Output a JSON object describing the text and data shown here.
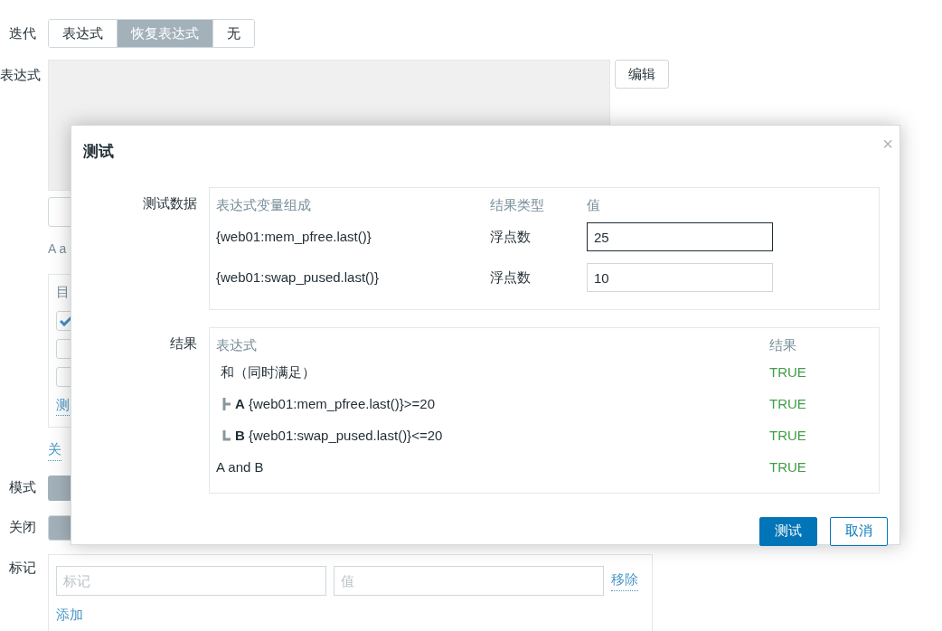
{
  "iteration": {
    "label": "迭代",
    "options": [
      {
        "label": "表达式",
        "selected": false
      },
      {
        "label": "恢复表达式",
        "selected": true
      },
      {
        "label": "无",
        "selected": false
      }
    ]
  },
  "expression": {
    "label": "表达式",
    "edit_button": "编辑"
  },
  "hint": "A a",
  "panel": {
    "header": "目",
    "checkboxes": [
      {
        "checked": true
      },
      {
        "checked": false
      },
      {
        "checked": false
      }
    ],
    "link": "测"
  },
  "close_link": "关",
  "mode_label": "模式",
  "close_label": "关闭",
  "tags": {
    "label": "标记",
    "rows": [
      {
        "tag_placeholder": "标记",
        "value_placeholder": "值",
        "remove": "移除"
      }
    ],
    "add": "添加"
  },
  "dialog": {
    "title": "测试",
    "close": "×",
    "test_data": {
      "label": "测试数据",
      "columns": [
        "表达式变量组成",
        "结果类型",
        "值"
      ],
      "rows": [
        {
          "expression": "{web01:mem_pfree.last()}",
          "type": "浮点数",
          "value": "25",
          "focused": true
        },
        {
          "expression": "{web01:swap_pused.last()}",
          "type": "浮点数",
          "value": "10",
          "focused": false
        }
      ]
    },
    "result": {
      "label": "结果",
      "columns": [
        "表达式",
        "结果"
      ],
      "rows": [
        {
          "expression": "和（同时满足）",
          "result": "TRUE",
          "children": [
            {
              "letter": "A",
              "expression": "{web01:mem_pfree.last()}>=20",
              "result": "TRUE"
            },
            {
              "letter": "B",
              "expression": "{web01:swap_pused.last()}<=20",
              "result": "TRUE"
            }
          ]
        },
        {
          "expression": "A and B",
          "result": "TRUE"
        }
      ]
    },
    "buttons": [
      {
        "label": "测试",
        "primary": true
      },
      {
        "label": "取消",
        "primary": false
      }
    ]
  }
}
